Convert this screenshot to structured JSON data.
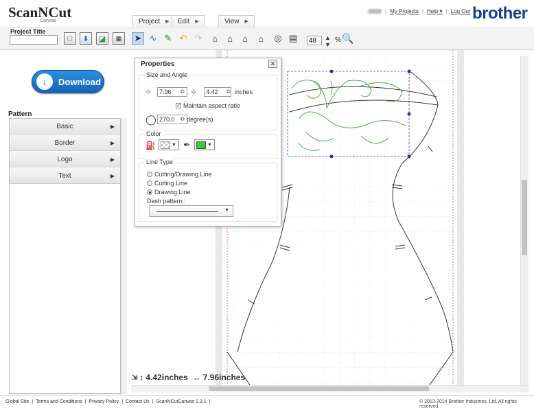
{
  "header": {
    "logo": "ScanNCut",
    "logo_sub": "Canvas",
    "menus": [
      "Project",
      "Edit",
      "View"
    ],
    "links": [
      "My Projects",
      "Help ▾",
      "Log Out"
    ],
    "brand": "brother"
  },
  "toolbar": {
    "project_title_label": "Project Title",
    "project_title_value": "",
    "zoom_value": "48",
    "zoom_unit": "%"
  },
  "left": {
    "download_label": "Download",
    "pattern_label": "Pattern",
    "items": [
      "Basic",
      "Border",
      "Logo",
      "Text"
    ]
  },
  "properties": {
    "title": "Properties",
    "close": "✕",
    "size_group": "Size and Angle",
    "width": "7.96",
    "height": "4.42",
    "unit": "inches",
    "maintain_ratio": "Maintain aspect ratio",
    "angle": "270.0",
    "angle_unit": "degree(s)",
    "color_group": "Color",
    "line_group": "Line Type",
    "line_options": [
      "Cutting/Drawing Line",
      "Cutting Line",
      "Drawing Line"
    ],
    "selected_line": 2,
    "dash_label": "Dash pattern :"
  },
  "canvas": {
    "height_readout": "4.42inches",
    "width_readout": "7.96inches",
    "stroke_color": "#3fb53f",
    "fill_swatch": "#33cc33"
  },
  "footer": {
    "links": [
      "Global Site",
      "Terms and Conditions",
      "Privacy Policy",
      "Contact Us",
      "ScanNCutCanvas 1.3.1"
    ],
    "copyright": "© 2013-2014 Brother Industries, Ltd. All rights reserved."
  }
}
